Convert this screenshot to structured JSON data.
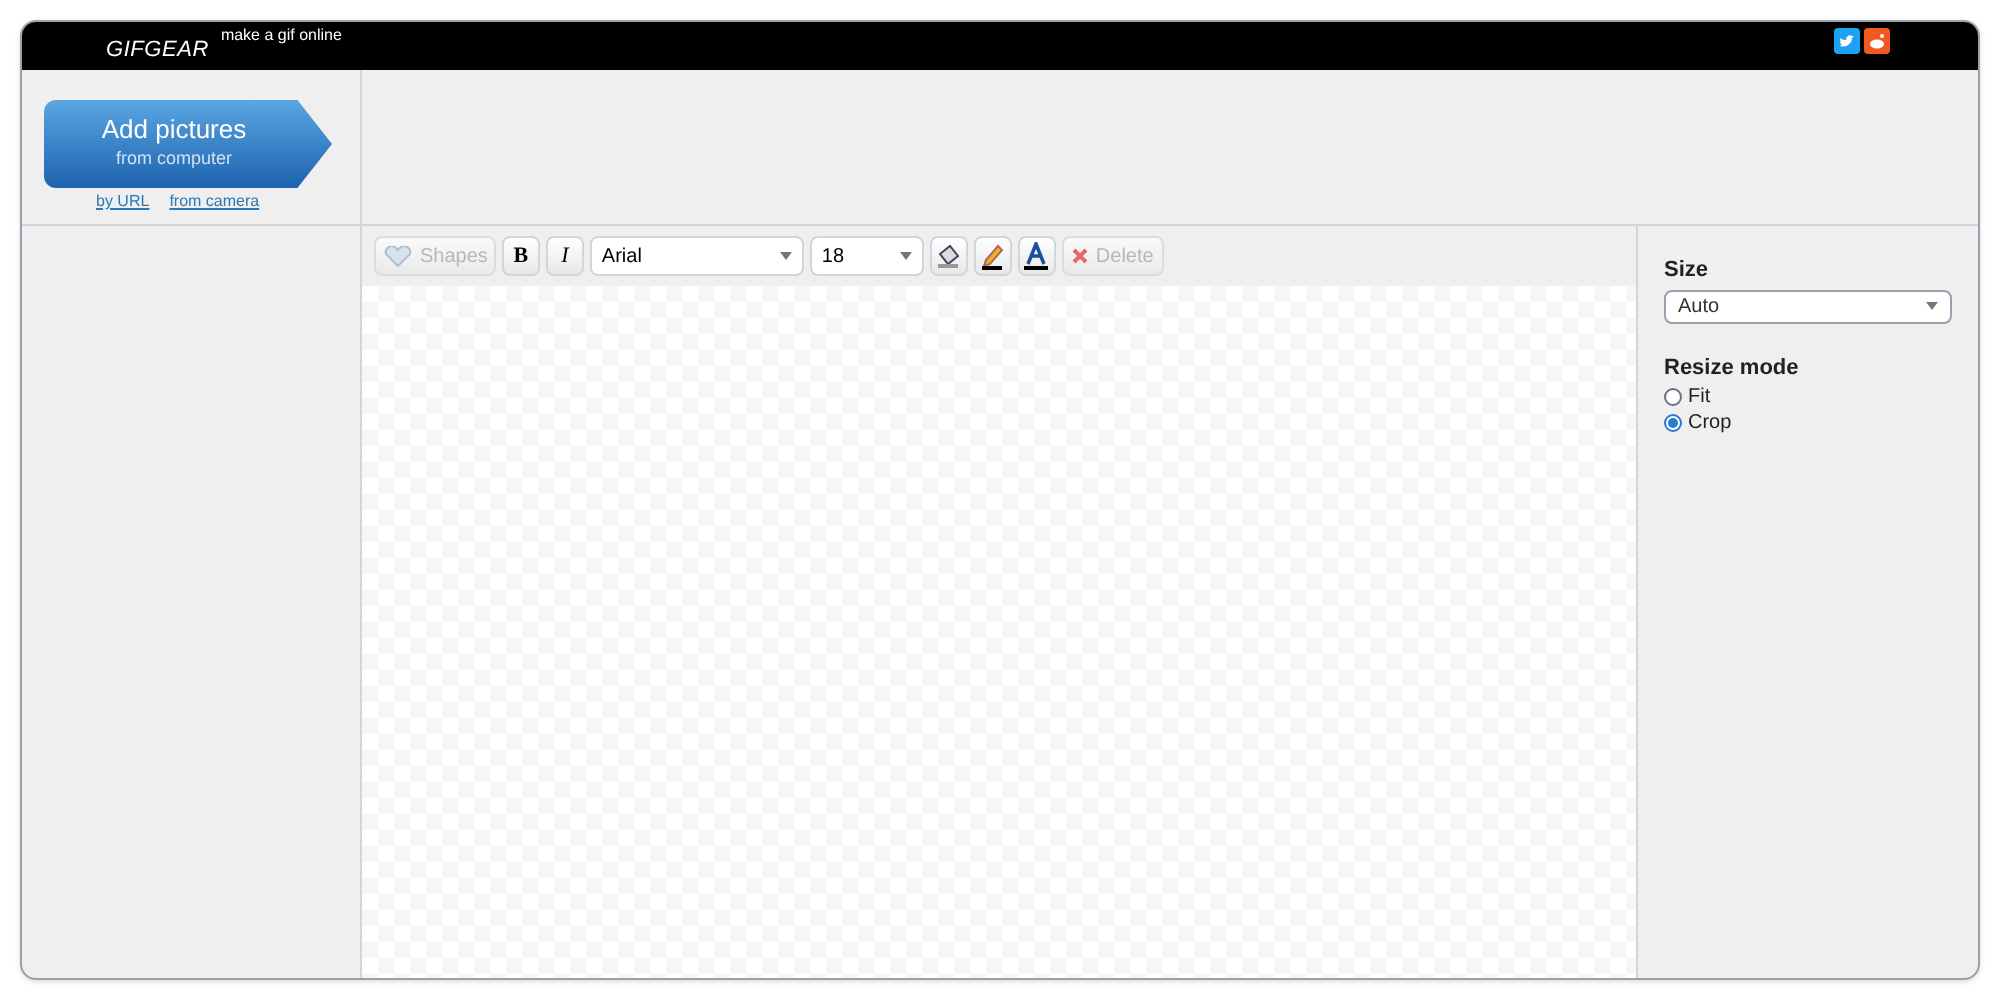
{
  "header": {
    "logo": "GIFGEAR",
    "tagline": "make a gif online"
  },
  "upload": {
    "button": "Add pictures",
    "subtitle": "from computer",
    "links": [
      "by URL",
      "from camera"
    ]
  },
  "toolbar": {
    "items": [
      {
        "kind": "shapes",
        "label": "Shapes",
        "disabled": true
      },
      {
        "kind": "bold",
        "label": "B",
        "disabled": false
      },
      {
        "kind": "italic",
        "label": "I",
        "disabled": false
      },
      {
        "kind": "select",
        "value": "Arial",
        "disabled": false
      },
      {
        "kind": "select",
        "value": "18",
        "disabled": false
      },
      {
        "kind": "fill",
        "disabled": false
      },
      {
        "kind": "pencil",
        "disabled": false
      },
      {
        "kind": "textcolor",
        "disabled": false
      },
      {
        "kind": "delete",
        "label": "Delete",
        "disabled": true
      }
    ]
  },
  "settings": {
    "size_label": "Size",
    "size_value": "Auto",
    "resize_label": "Resize mode",
    "resize_options": [
      {
        "label": "Fit",
        "selected": false
      },
      {
        "label": "Crop",
        "selected": true
      }
    ]
  }
}
